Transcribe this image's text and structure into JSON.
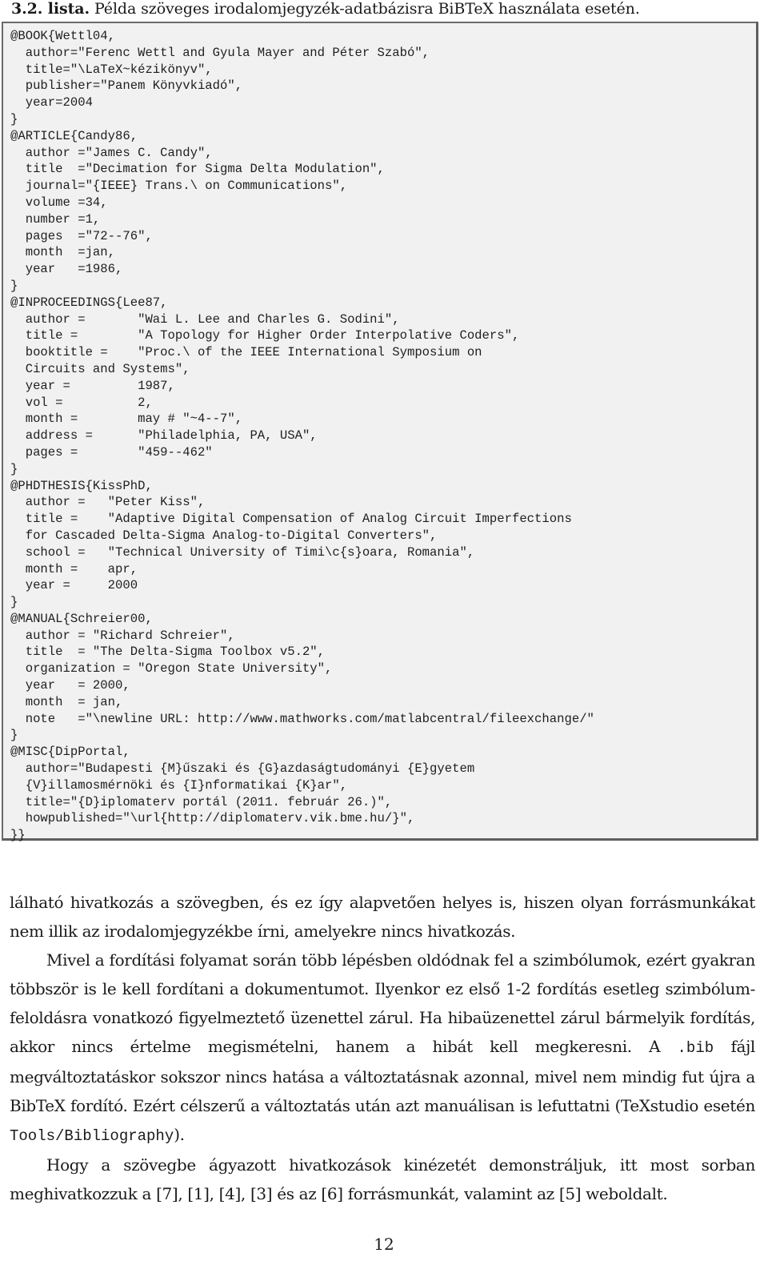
{
  "caption": {
    "label": "3.2. lista.",
    "text": " Példa szöveges irodalomjegyzék-adatbázisra BiBTeX használata esetén."
  },
  "code_listing": {
    "lines": [
      "@BOOK{Wettl04,",
      "  author=\"Ferenc Wettl and Gyula Mayer and Péter Szabó\",",
      "  title=\"\\LaTeX~kézikönyv\",",
      "  publisher=\"Panem Könyvkiadó\",",
      "  year=2004",
      "}",
      "@ARTICLE{Candy86,",
      "  author =\"James C. Candy\",",
      "  title  =\"Decimation for Sigma Delta Modulation\",",
      "  journal=\"{IEEE} Trans.\\ on Communications\",",
      "  volume =34,",
      "  number =1,",
      "  pages  =\"72--76\",",
      "  month  =jan,",
      "  year   =1986,",
      "}",
      "@INPROCEEDINGS{Lee87,",
      "  author =       \"Wai L. Lee and Charles G. Sodini\",",
      "  title =        \"A Topology for Higher Order Interpolative Coders\",",
      "  booktitle =    \"Proc.\\ of the IEEE International Symposium on",
      "  Circuits and Systems\",",
      "  year =         1987,",
      "  vol =          2,",
      "  month =        may # \"~4--7\",",
      "  address =      \"Philadelphia, PA, USA\",",
      "  pages =        \"459--462\"",
      "}",
      "@PHDTHESIS{KissPhD,",
      "  author =   \"Peter Kiss\",",
      "  title =    \"Adaptive Digital Compensation of Analog Circuit Imperfections",
      "  for Cascaded Delta-Sigma Analog-to-Digital Converters\",",
      "  school =   \"Technical University of Timi\\c{s}oara, Romania\",",
      "  month =    apr,",
      "  year =     2000",
      "}",
      "@MANUAL{Schreier00,",
      "  author = \"Richard Schreier\",",
      "  title  = \"The Delta-Sigma Toolbox v5.2\",",
      "  organization = \"Oregon State University\",",
      "  year   = 2000,",
      "  month  = jan,",
      "  note   =\"\\newline URL: http://www.mathworks.com/matlabcentral/fileexchange/\"",
      "}",
      "@MISC{DipPortal,",
      "  author=\"Budapesti {M}űszaki és {G}azdaságtudományi {E}gyetem",
      "  {V}illamosmérnöki és {I}nformatikai {K}ar\",",
      "  title=\"{D}iplomaterv portál (2011. február 26.)\",",
      "  howpublished=\"\\url{http://diplomaterv.vik.bme.hu/}\",",
      "}}"
    ]
  },
  "paragraphs": [
    {
      "text": "lálható hivatkozás a szövegben, és ez így alapvetően helyes is, hiszen olyan forrásmunkákat nem illik az irodalomjegyzékbe írni, amelyekre nincs hivatkozás."
    },
    {
      "text_before": "Mivel a fordítási folyamat során több lépésben oldódnak fel a szimbólumok, ezért gyakran többször is le kell fordítani a dokumentumot. Ilyenkor ez első 1-2 fordítás esetleg szimbólum-feloldásra vonatkozó figyelmeztető üzenettel zárul. Ha hibaüzenettel zárul bármelyik fordítás, akkor nincs értelme megismételni, hanem a hibát kell megkeresni. A ",
      "code1": ".bib",
      "text_middle": " fájl megváltoztatáskor sokszor nincs hatása a változtatásnak azonnal, mivel nem mindig fut újra a BibTeX fordító. Ezért célszerű a változtatás után azt manuálisan is lefuttatni (TeXstudio esetén ",
      "code2": "Tools/Bibliography",
      "text_after": ")."
    },
    {
      "text": "Hogy a szövegbe ágyazott hivatkozások kinézetét demonstráljuk, itt most sorban meghivatkozzuk a [7], [1], [4], [3] és az [6] forrásmunkát, valamint az [5] weboldalt."
    }
  ],
  "page_number": "12"
}
